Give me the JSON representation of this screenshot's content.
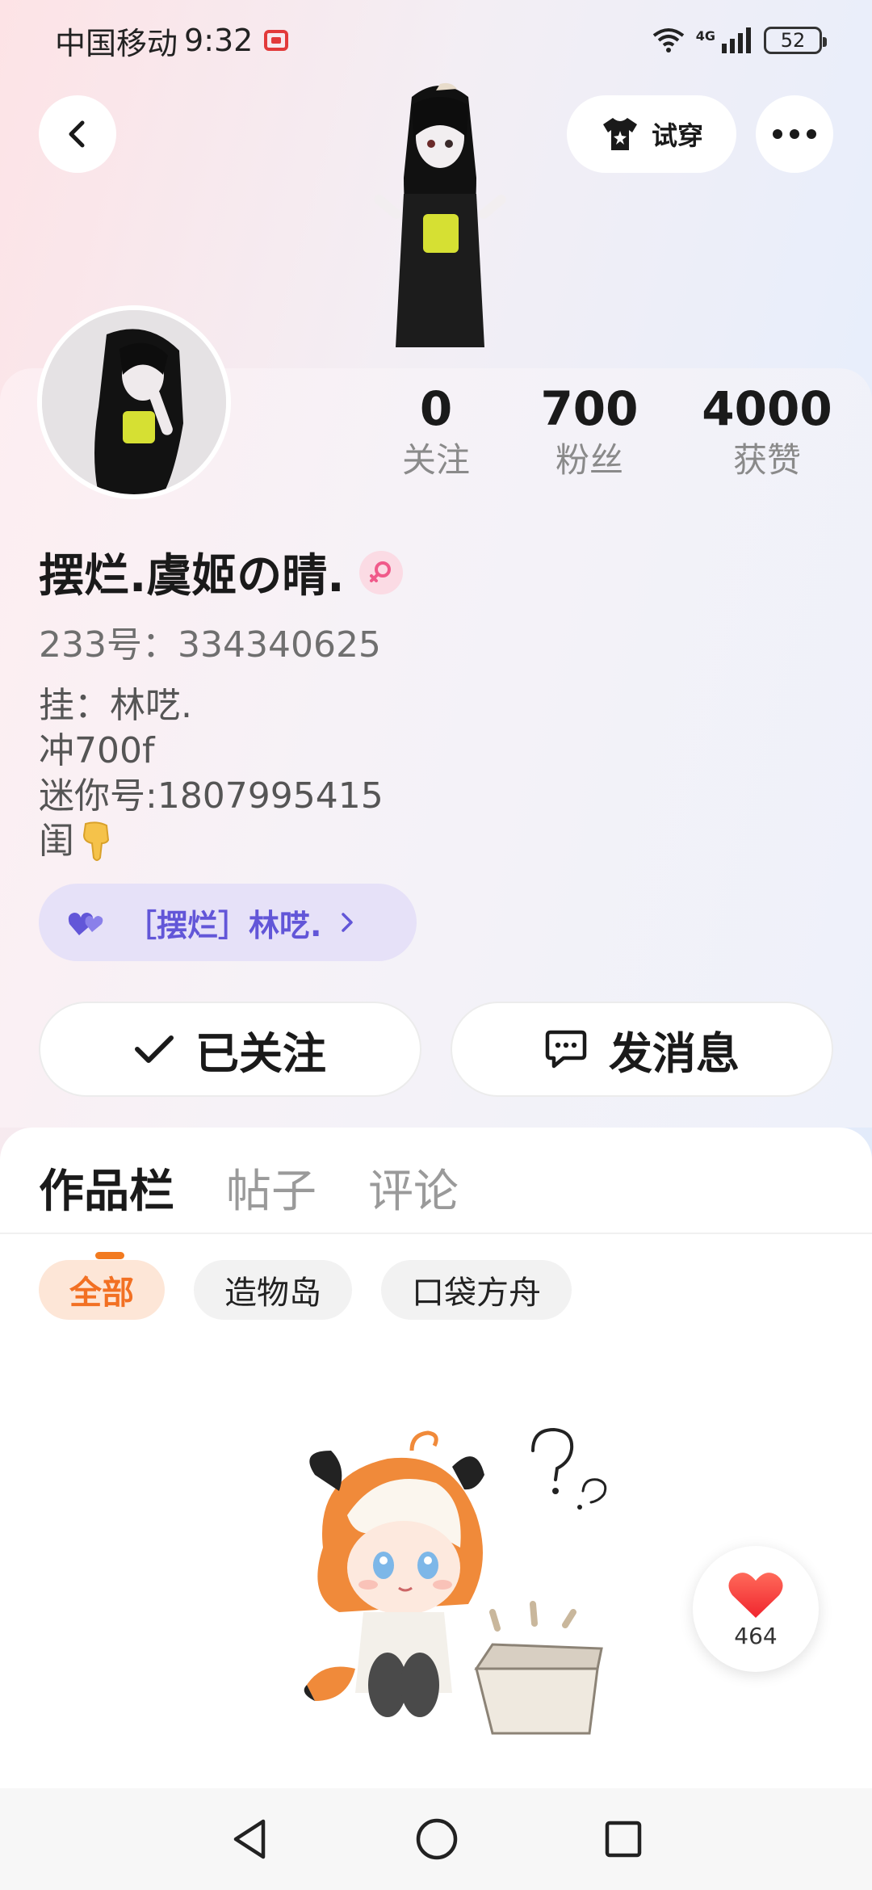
{
  "status_bar": {
    "carrier": "中国移动",
    "time": "9:32",
    "network": "4G",
    "battery": "52"
  },
  "header": {
    "tryon_label": "试穿"
  },
  "profile": {
    "stats": [
      {
        "value": "0",
        "label": "关注"
      },
      {
        "value": "700",
        "label": "粉丝"
      },
      {
        "value": "4000",
        "label": "获赞"
      }
    ],
    "username": "摆烂.虞姬の晴.",
    "gender": "female",
    "uid": "233号：334340625",
    "bio_lines": [
      "挂：林呓.",
      "冲700f",
      "迷你号:1807995415",
      "闺"
    ],
    "guild_label": "［摆烂］林呓.",
    "followed_label": "已关注",
    "message_label": "发消息"
  },
  "content": {
    "tabs": [
      "作品栏",
      "帖子",
      "评论"
    ],
    "active_tab": 0,
    "chips": [
      "全部",
      "造物岛",
      "口袋方舟"
    ],
    "active_chip": 0,
    "like_count": "464"
  },
  "colors": {
    "accent": "#f27a20",
    "guild_bg": "#e6e1f8",
    "guild_text": "#6256d8",
    "like_red": "#f23b3b"
  }
}
